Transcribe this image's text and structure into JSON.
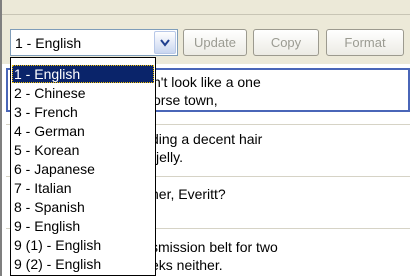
{
  "toolbar": {
    "language_value": "1 - English",
    "update_label": "Update",
    "copy_label": "Copy",
    "format_label": "Format"
  },
  "rows": [
    {
      "lines": [
        "n't look like a one",
        "orse town,"
      ]
    },
    {
      "lines": [
        "ding a decent hair",
        "jelly."
      ]
    },
    {
      "lines": [
        "her, Everitt?"
      ]
    },
    {
      "lines": [
        "smission belt for two",
        "eks neither."
      ]
    }
  ],
  "dropdown": {
    "options": [
      "1 - English",
      "2 - Chinese",
      "3 - French",
      "4 - German",
      "5 - Korean",
      "6 - Japanese",
      "7 - Italian",
      "8 - Spanish",
      "9 - English",
      "9 (1) - English",
      "9 (2) - English"
    ],
    "selected_index": 0
  }
}
